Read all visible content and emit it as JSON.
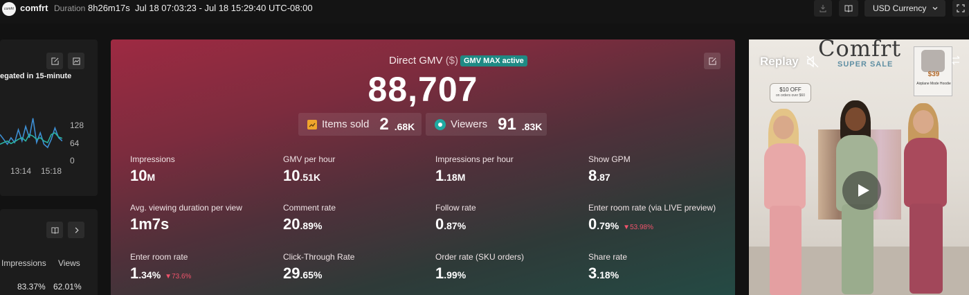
{
  "header": {
    "brand": "comfrt",
    "logo_text": "comfrt",
    "duration_label": "Duration",
    "duration_value": "8h26m17s",
    "time_range": "Jul 18 07:03:23 - Jul 18 15:29:40 UTC-08:00",
    "currency": "USD Currency"
  },
  "left_panel": {
    "aggregated_text": "egated in 15-minute",
    "chart_data": {
      "type": "line",
      "x_ticks": [
        "13:14",
        "15:18"
      ],
      "y_ticks": [
        "128",
        "64",
        "0"
      ],
      "series": [
        {
          "color": "#3d8fd4",
          "values": [
            70,
            55,
            40,
            60,
            45,
            85,
            50,
            95,
            60,
            120,
            45,
            75,
            40,
            30,
            55,
            90,
            60,
            50
          ]
        },
        {
          "color": "#2bb3a3",
          "values": [
            40,
            45,
            50,
            42,
            48,
            55,
            60,
            50,
            70,
            65,
            55,
            60,
            50,
            45,
            70,
            75,
            62,
            58
          ]
        }
      ],
      "ylim": [
        0,
        128
      ]
    },
    "columns": [
      {
        "header": "Impressions",
        "value": "83.37%"
      },
      {
        "header": "Views",
        "value": "62.01%"
      }
    ]
  },
  "main": {
    "title": "Direct GMV",
    "title_unit": "($)",
    "badge": "GMV MAX active",
    "gmv_value": "88,707",
    "chips": [
      {
        "label": "Items sold",
        "value": "2",
        "unit": ".68K"
      },
      {
        "label": "Viewers",
        "value": "91",
        "unit": ".83K"
      }
    ],
    "metrics": [
      {
        "label": "Impressions",
        "value": "10",
        "unit": "M",
        "delta": ""
      },
      {
        "label": "GMV per hour",
        "value": "10",
        "unit": ".51K",
        "delta": ""
      },
      {
        "label": "Impressions per hour",
        "value": "1",
        "unit": ".18M",
        "delta": ""
      },
      {
        "label": "Show GPM",
        "value": "8",
        "unit": ".87",
        "delta": ""
      },
      {
        "label": "Avg. viewing duration per view",
        "value": "1m7s",
        "unit": "",
        "delta": ""
      },
      {
        "label": "Comment rate",
        "value": "20",
        "unit": ".89%",
        "delta": ""
      },
      {
        "label": "Follow rate",
        "value": "0",
        "unit": ".87%",
        "delta": ""
      },
      {
        "label": "Enter room rate (via LIVE preview)",
        "value": "0",
        "unit": ".79%",
        "delta": "53.98%"
      },
      {
        "label": "Enter room rate",
        "value": "1",
        "unit": ".34%",
        "delta": "73.6%"
      },
      {
        "label": "Click-Through Rate",
        "value": "29",
        "unit": ".65%",
        "delta": ""
      },
      {
        "label": "Order rate (SKU orders)",
        "value": "1",
        "unit": ".99%",
        "delta": ""
      },
      {
        "label": "Share rate",
        "value": "3",
        "unit": ".18%",
        "delta": ""
      }
    ]
  },
  "replay": {
    "title": "Replay",
    "logo": "Comfrt",
    "super_sale": "SUPER SALE",
    "promo_line1": "$10 OFF",
    "promo_line2": "on orders over $60",
    "product_price": "$39",
    "product_name": "Airplane Mode Hoodie"
  }
}
